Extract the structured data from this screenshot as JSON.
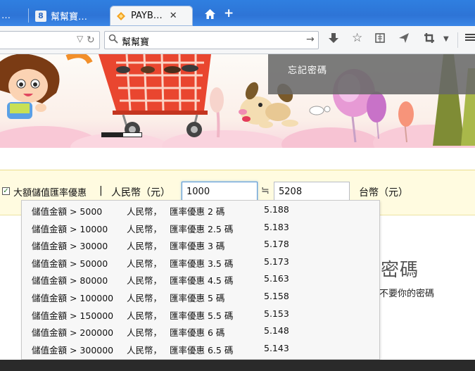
{
  "browser": {
    "tabs": [
      {
        "title": "…",
        "state": "inactive"
      },
      {
        "title": "幫幫寶…",
        "favicon_text": "8",
        "state": "inactive"
      },
      {
        "title": "PAYB…",
        "state": "active"
      }
    ],
    "tab_close_glyph": "✕",
    "home_icon": "⌂",
    "new_tab_glyph": "+",
    "search_value": "幫幫寶"
  },
  "banner": {
    "forgot_password": "忘記密碼"
  },
  "converter": {
    "promo_label": "大額儲值匯率優惠",
    "separator": "|",
    "cny_label": "人民幣（元）",
    "cny_value": "1000",
    "approx": "≒",
    "twd_value": "5208",
    "twd_label": "台幣（元）",
    "promo_checked": true
  },
  "rate_options": [
    {
      "amount": "儲值金額 > 5000",
      "currency": "人民幣，",
      "promo": "匯率優惠 2 碼",
      "rate": "5.188"
    },
    {
      "amount": "儲值金額 > 10000",
      "currency": "人民幣，",
      "promo": "匯率優惠 2.5 碼",
      "rate": "5.183"
    },
    {
      "amount": "儲值金額 > 30000",
      "currency": "人民幣，",
      "promo": "匯率優惠 3 碼",
      "rate": "5.178"
    },
    {
      "amount": "儲值金額 > 50000",
      "currency": "人民幣，",
      "promo": "匯率優惠 3.5 碼",
      "rate": "5.173"
    },
    {
      "amount": "儲值金額 > 80000",
      "currency": "人民幣，",
      "promo": "匯率優惠 4.5 碼",
      "rate": "5.163"
    },
    {
      "amount": "儲值金額 > 100000",
      "currency": "人民幣，",
      "promo": "匯率優惠 5 碼",
      "rate": "5.158"
    },
    {
      "amount": "儲值金額 > 150000",
      "currency": "人民幣，",
      "promo": "匯率優惠 5.5 碼",
      "rate": "5.153"
    },
    {
      "amount": "儲值金額 > 200000",
      "currency": "人民幣，",
      "promo": "匯率優惠 6 碼",
      "rate": "5.148"
    },
    {
      "amount": "儲值金額 > 300000",
      "currency": "人民幣，",
      "promo": "匯率優惠 6.5 碼",
      "rate": "5.143"
    }
  ],
  "login": {
    "title": "密碼",
    "subtitle": "不要你的密碼"
  },
  "colors": {
    "tabbar": "#2f7fe0",
    "converter_bg": "#fffbe0",
    "dropdown_bg": "#f7f7f7",
    "forgot_panel": "#696969"
  }
}
